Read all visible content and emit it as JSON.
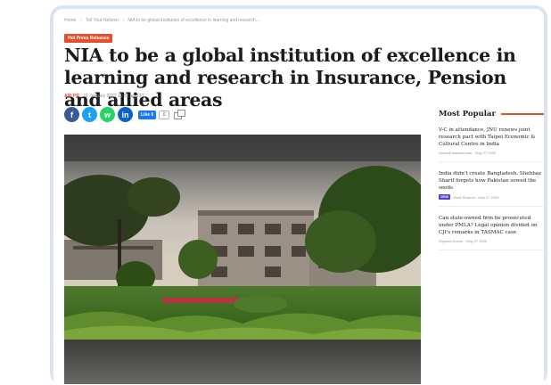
{
  "article": {
    "breadcrumb": [
      "Home",
      "›",
      "Tell Your Netizen",
      "›",
      "NIA to be global institution of excellence in learning and research..."
    ],
    "tag": "Hot Press Releases",
    "headline": "NIA to be a global institution of excellence in learning and research in Insurance, Pension and allied areas",
    "author": "ANI PR",
    "date": "21 January 2022 11:29 am IST"
  },
  "share": {
    "icons": [
      "facebook-icon",
      "twitter-icon",
      "whatsapp-icon",
      "linkedin-icon"
    ],
    "facebook_glyph": "f",
    "twitter_glyph": "t",
    "whatsapp_glyph": "w",
    "linkedin_glyph": "in",
    "like_label": "Like 0",
    "count": "0"
  },
  "sidebar": {
    "title": "Most Popular",
    "accent_color": "#e4502c",
    "items": [
      {
        "title": "V-C in attendance, JNU renews joint research pact with Taipei Economic & Cultural Centre in India",
        "pill": "",
        "meta": "Sanhati Nandakumar · May 27 2025"
      },
      {
        "title": "India didn't create Bangladesh. Shehbaz Sharif forgets how Pakistan sowed the seeds",
        "pill": "VIEW",
        "meta": "Vivek Sharma · May 27 2025"
      },
      {
        "title": "Can state-owned firm be prosecuted under PMLA? Legal opinion divided on CJI's remarks in TASMAC case",
        "pill": "",
        "meta": "Shyanta Kumar · May 27 2025"
      }
    ]
  },
  "colors": {
    "frame": "#dbe3f3",
    "tag_bg": "#e4502c",
    "pill_bg": "#5b3fc4"
  }
}
